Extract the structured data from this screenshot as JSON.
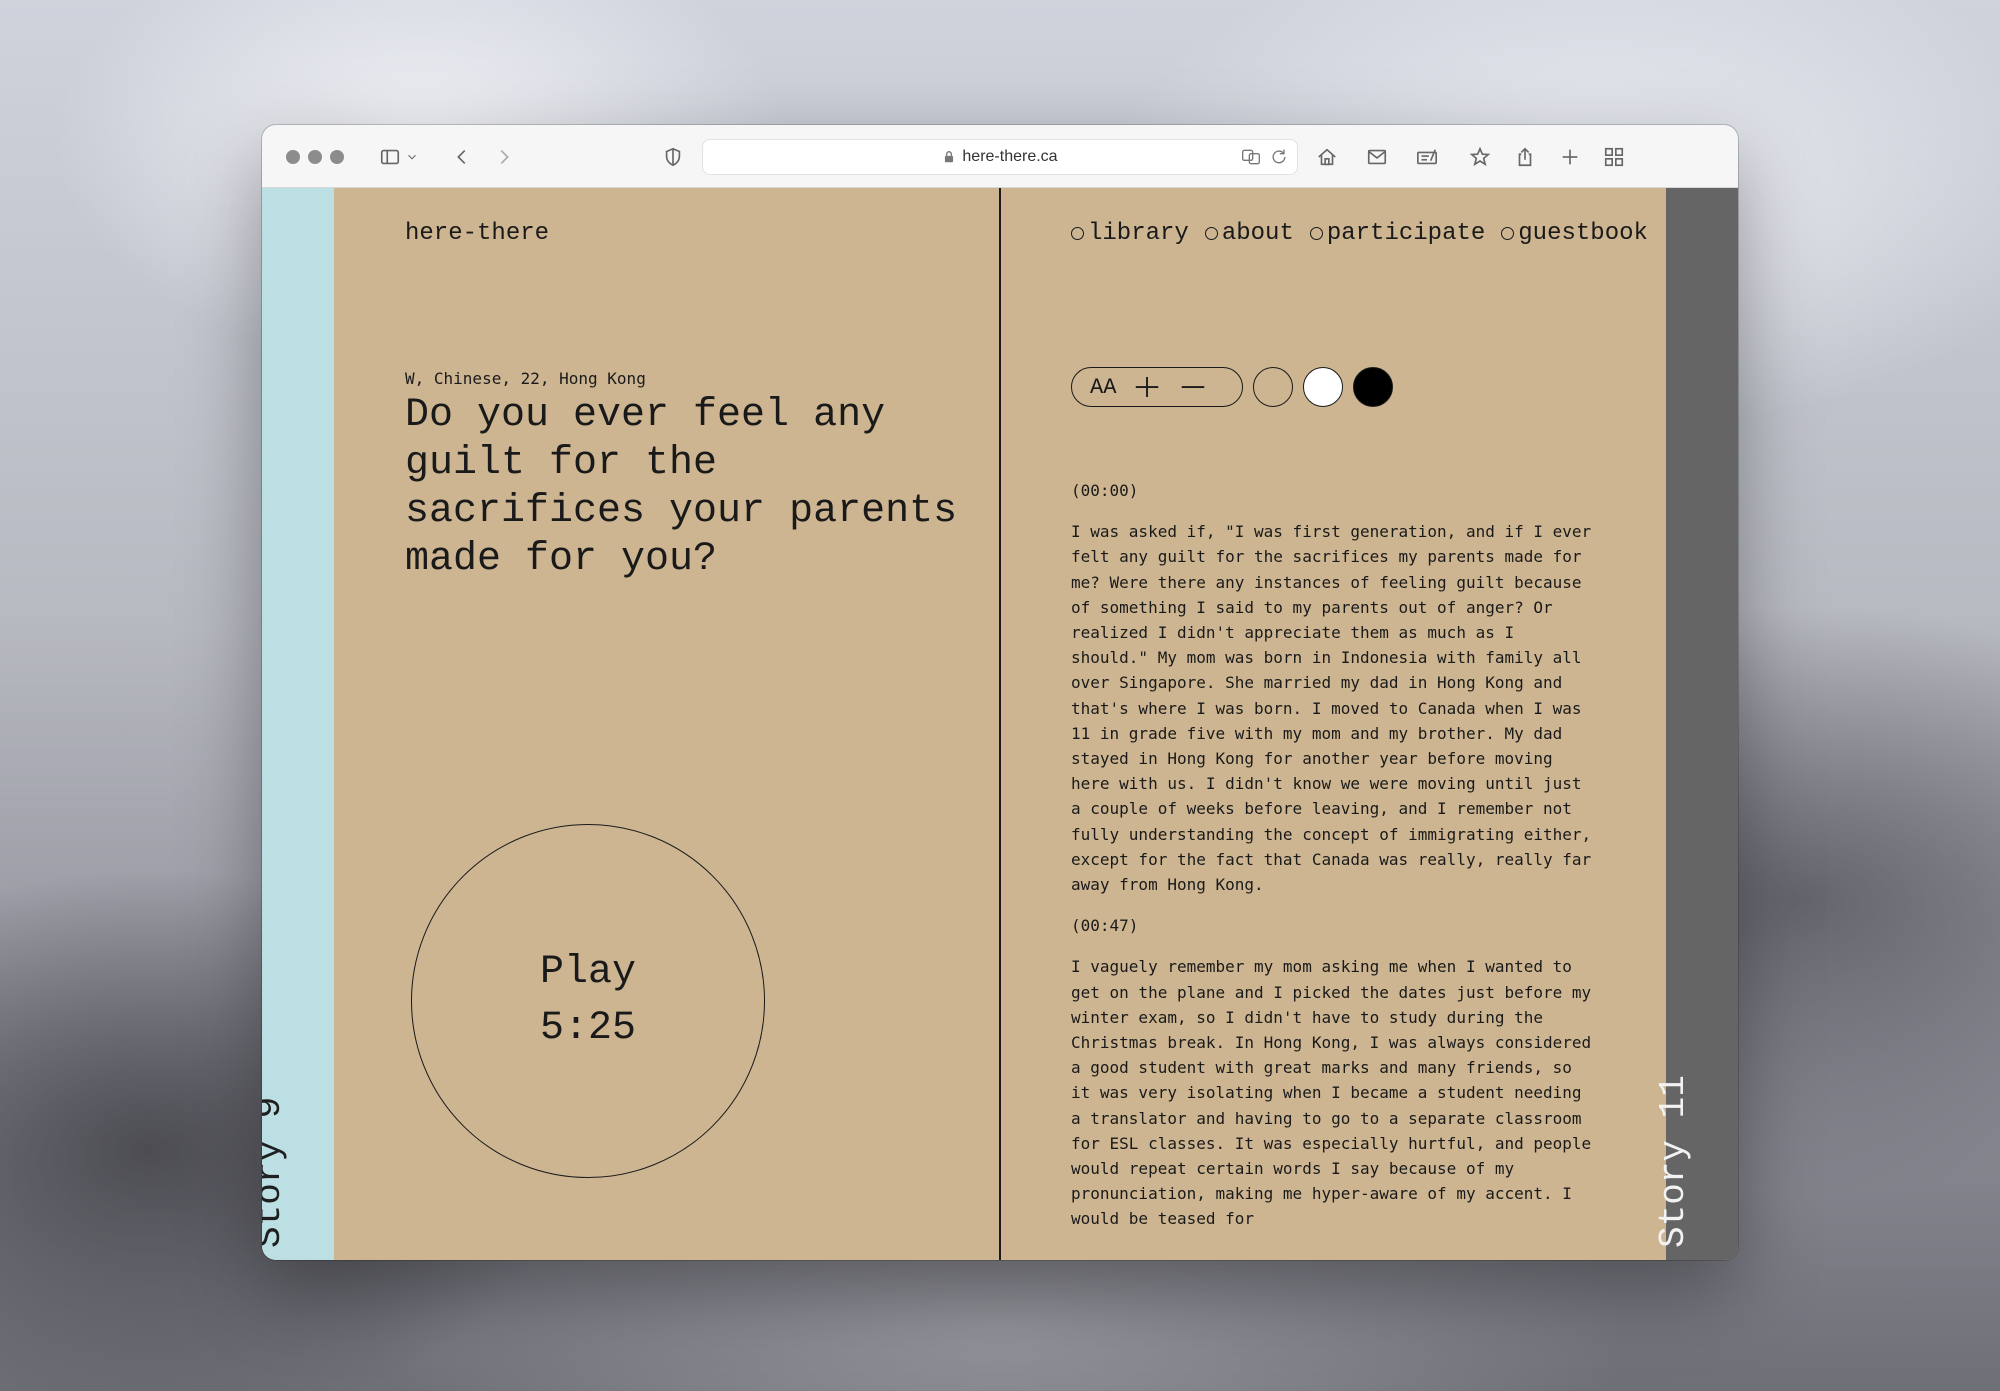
{
  "browser": {
    "url": "here-there.ca"
  },
  "site": {
    "logo": "here-there",
    "nav": [
      {
        "label": "library"
      },
      {
        "label": "about"
      },
      {
        "label": "participate"
      },
      {
        "label": "guestbook"
      }
    ]
  },
  "left_tab": {
    "label": "Story 9",
    "color": "#bcdfe4"
  },
  "right_tab": {
    "label": "Story 11",
    "color": "#656565"
  },
  "story": {
    "meta": "W, Chinese, 22, Hong Kong",
    "question": "Do you ever feel any guilt for the sacrifices your parents made for you?",
    "play_label": "Play",
    "duration": "5:25"
  },
  "controls": {
    "font_label": "AA",
    "swatches": [
      {
        "name": "tan",
        "color": "#cdb591"
      },
      {
        "name": "white",
        "color": "#ffffff"
      },
      {
        "name": "black",
        "color": "#000000"
      }
    ]
  },
  "transcript": [
    {
      "type": "timestamp",
      "text": "(00:00)"
    },
    {
      "type": "paragraph",
      "text": "I was asked if, \"I was first generation, and if I ever felt any guilt for the sacrifices my parents made for me? Were there any instances of feeling guilt because of something I said to my parents out of anger? Or realized I didn't appreciate them as much as I should.\" My mom was born in Indonesia with family all over Singapore. She married my dad in Hong Kong and that's where I was born. I moved to Canada when I was 11 in grade five with my mom and my brother. My dad stayed in Hong Kong for another year before moving here with us. I didn't know we were moving until just a couple of weeks before leaving, and I remember not fully understanding the concept of immigrating either, except for the fact that Canada was really, really far away from Hong Kong."
    },
    {
      "type": "timestamp",
      "text": "(00:47)"
    },
    {
      "type": "paragraph",
      "text": "I vaguely remember my mom asking me when I wanted to get on the plane and I picked the dates just before my winter exam, so I didn't have to study during the Christmas break. In Hong Kong, I was always considered a good student with great marks and many friends, so it was very isolating when I became a student needing a translator and having to go to a separate classroom for ESL classes. It was especially hurtful, and people would repeat certain words I say because of my pronunciation, making me hyper-aware of my accent. I would be teased for"
    }
  ]
}
